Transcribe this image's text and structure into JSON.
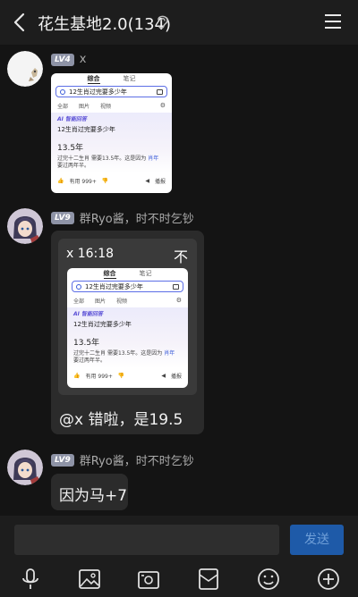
{
  "header": {
    "title": "花生基地2.0(134)"
  },
  "messages": [
    {
      "level": "LV4",
      "name": "x",
      "shot": {
        "tabs": [
          "综合",
          "笔记"
        ],
        "query": "12生肖过完要多少年",
        "subtabs": [
          "全部",
          "图片",
          "视频"
        ],
        "ai_label": "AI 智能回答",
        "question": "12生肖过完要多少年",
        "answer": "13.5年",
        "desc_pre": "过完十二生肖",
        "desc_mid": "需要13.5年。这是因为",
        "desc_hl": "肖年",
        "desc_post": "要过两年半。",
        "useful": "有用 999+",
        "play": "播报"
      }
    },
    {
      "level": "LV9",
      "name": "群Ryo酱，时不时乞钞",
      "card_time": "x 16:18",
      "pin_glyph": "不",
      "text": "@x 错啦，是19.5"
    },
    {
      "level": "LV9",
      "name": "群Ryo酱，时不时乞钞",
      "text": "因为马+7"
    }
  ],
  "input": {
    "send_label": "发送"
  },
  "toolbar": [
    "mic-icon",
    "image-icon",
    "camera-icon",
    "file-icon",
    "emoji-icon",
    "plus-icon"
  ]
}
